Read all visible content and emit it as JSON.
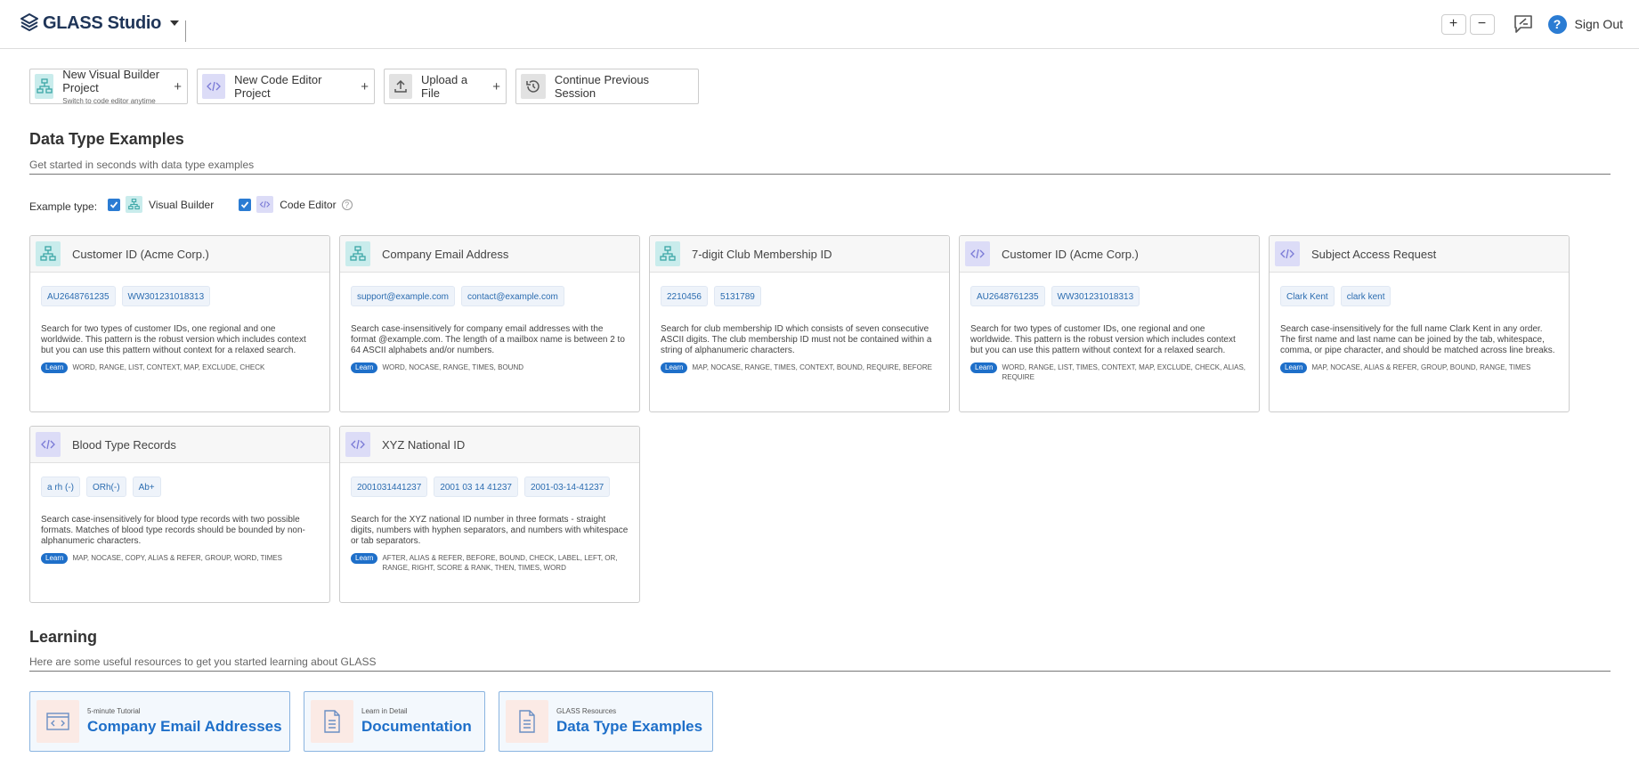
{
  "app": {
    "name": "GLASS Studio"
  },
  "header": {
    "zoom_in": "+",
    "zoom_out": "−",
    "sign_out": "Sign Out",
    "help": "?"
  },
  "actions": [
    {
      "label": "New Visual Builder Project",
      "sub": "Switch to code editor anytime",
      "icon": "visual-builder-icon",
      "plus": "+"
    },
    {
      "label": "New Code Editor Project",
      "icon": "code-editor-icon",
      "plus": "+"
    },
    {
      "label": "Upload a File",
      "icon": "upload-icon",
      "plus": "+"
    },
    {
      "label": "Continue Previous Session",
      "icon": "history-icon"
    }
  ],
  "examples": {
    "title": "Data Type Examples",
    "subtitle": "Get started in seconds with data type examples",
    "filter_label": "Example type:",
    "filter_visual": "Visual Builder",
    "filter_code": "Code Editor",
    "learn_label": "Learn",
    "cards": [
      {
        "type": "visual",
        "title": "Customer ID (Acme Corp.)",
        "chips": [
          "AU2648761235",
          "WW301231018313"
        ],
        "desc": "Search for two types of customer IDs, one regional and one worldwide. This pattern is the robust version which includes context but you can use this pattern without context for a relaxed search.",
        "keywords": "WORD, RANGE, LIST, CONTEXT, MAP, EXCLUDE, CHECK"
      },
      {
        "type": "visual",
        "title": "Company Email Address",
        "chips": [
          "support@example.com",
          "contact@example.com"
        ],
        "desc": "Search case-insensitively for company email addresses with the format @example.com. The length of a mailbox name is between 2 to 64 ASCII alphabets and/or numbers.",
        "keywords": "WORD, NOCASE, RANGE, TIMES, BOUND"
      },
      {
        "type": "visual",
        "title": "7-digit Club Membership ID",
        "chips": [
          "2210456",
          "5131789"
        ],
        "desc": "Search for club membership ID which consists of seven consecutive ASCII digits. The club membership ID must not be contained within a string of alphanumeric characters.",
        "keywords": "MAP, NOCASE, RANGE, TIMES, CONTEXT, BOUND, REQUIRE, BEFORE"
      },
      {
        "type": "code",
        "title": "Customer ID (Acme Corp.)",
        "chips": [
          "AU2648761235",
          "WW301231018313"
        ],
        "desc": "Search for two types of customer IDs, one regional and one worldwide. This pattern is the robust version which includes context but you can use this pattern without context for a relaxed search.",
        "keywords": "WORD, RANGE, LIST, TIMES, CONTEXT, MAP, EXCLUDE, CHECK, ALIAS, REQUIRE"
      },
      {
        "type": "code",
        "title": "Subject Access Request",
        "chips": [
          "Clark Kent",
          "clark kent"
        ],
        "desc": "Search case-insensitively for the full name Clark Kent in any order. The first name and last name can be joined by the tab, whitespace, comma, or pipe character, and should be matched across line breaks.",
        "keywords": "MAP, NOCASE, ALIAS & REFER, GROUP, BOUND, RANGE, TIMES"
      },
      {
        "type": "code",
        "title": "Blood Type Records",
        "chips": [
          "a rh (-)",
          "ORh(-)",
          "Ab+"
        ],
        "desc": "Search case-insensitively for blood type records with two possible formats. Matches of blood type records should be bounded by non-alphanumeric characters.",
        "keywords": "MAP, NOCASE, COPY, ALIAS & REFER, GROUP, WORD, TIMES"
      },
      {
        "type": "code",
        "title": "XYZ National ID",
        "chips": [
          "2001031441237",
          "2001 03 14 41237",
          "2001-03-14-41237"
        ],
        "desc": "Search for the XYZ national ID number in three formats - straight digits, numbers with hyphen separators, and numbers with whitespace or tab separators.",
        "keywords": "AFTER, ALIAS & REFER, BEFORE, BOUND, CHECK, LABEL, LEFT, OR, RANGE, RIGHT, SCORE & RANK, THEN, TIMES, WORD"
      }
    ]
  },
  "learning": {
    "title": "Learning",
    "subtitle": "Here are some useful resources to get you started learning about GLASS",
    "cards": [
      {
        "small": "5-minute Tutorial",
        "big": "Company Email Addresses",
        "icon": "browser-code-icon"
      },
      {
        "small": "Learn in Detail",
        "big": "Documentation",
        "icon": "document-icon"
      },
      {
        "small": "GLASS Resources",
        "big": "Data Type Examples",
        "icon": "document-icon"
      }
    ]
  },
  "colors": {
    "accent": "#2b7cd3",
    "brand": "#1f3558",
    "learn_badge": "#1e6fc9"
  }
}
